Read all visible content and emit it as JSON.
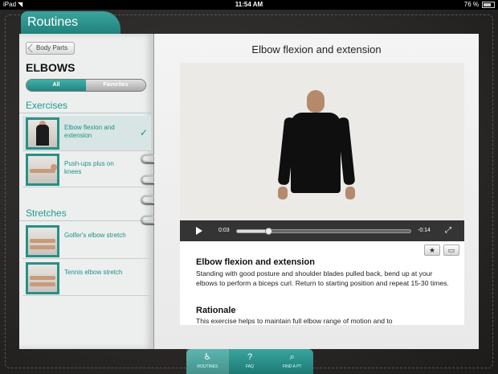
{
  "status": {
    "device": "iPad",
    "time": "11:54 AM",
    "battery": "76 %",
    "battery_level": 0.76
  },
  "header": {
    "tab_title": "Routines"
  },
  "sidebar": {
    "back_label": "Body Parts",
    "heading": "ELBOWS",
    "filter": {
      "all": "All",
      "favorites": "Favorites",
      "selected": "All"
    },
    "sections": [
      {
        "title": "Exercises",
        "items": [
          {
            "label": "Elbow flexion and extension",
            "selected": true
          },
          {
            "label": "Push-ups plus on knees",
            "selected": false
          }
        ]
      },
      {
        "title": "Stretches",
        "items": [
          {
            "label": "Golfer's elbow stretch",
            "selected": false
          },
          {
            "label": "Tennis elbow stretch",
            "selected": false
          }
        ]
      }
    ],
    "check_icon": "✓"
  },
  "main": {
    "video_title": "Elbow flexion and extension",
    "player": {
      "current_time": "0:03",
      "remaining_time": "-0:14",
      "progress": 0.18
    },
    "exercise_title": "Elbow flexion and extension",
    "exercise_desc": "Standing with good posture and shoulder blades pulled back, bend up at your elbows to perform a biceps curl. Return to starting position and repeat 15-30 times.",
    "rationale_title": "Rationale",
    "rationale_desc": "This exercise helps to maintain full elbow range of motion and to"
  },
  "tabbar": {
    "items": [
      {
        "label": "ROUTINES",
        "icon": "person-icon",
        "active": true
      },
      {
        "label": "FAQ",
        "icon": "question-icon",
        "active": false
      },
      {
        "label": "FIND A PT",
        "icon": "search-icon",
        "active": false
      }
    ]
  },
  "colors": {
    "accent": "#1e9a92"
  }
}
